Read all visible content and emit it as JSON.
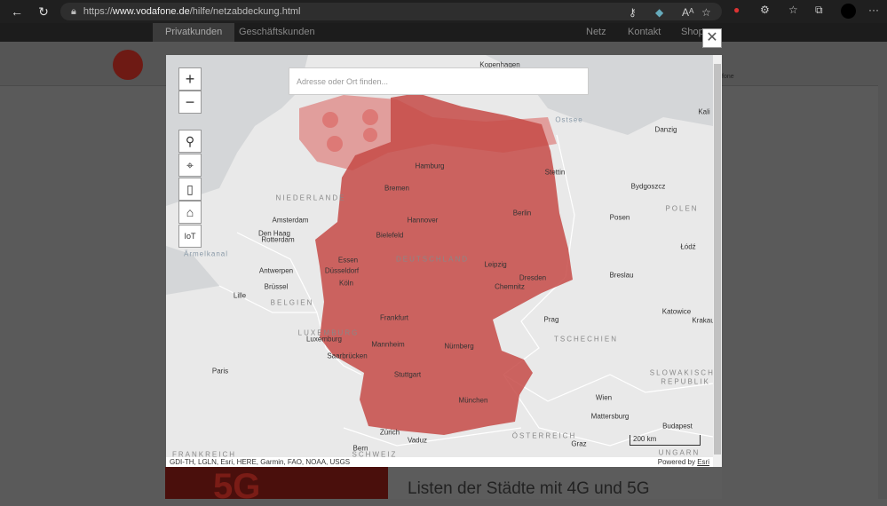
{
  "browser": {
    "url_prefix": "https://",
    "url_domain": "www.vodafone.de",
    "url_path": "/hilfe/netzabdeckung.html",
    "more": "···"
  },
  "nav": {
    "tabs": [
      "Privatkunden",
      "Geschäftskunden"
    ],
    "links": [
      "Netz",
      "Kontakt",
      "Shop"
    ]
  },
  "header": {
    "partial_text": "fone"
  },
  "map": {
    "search_placeholder": "Adresse oder Ort finden...",
    "labels": [
      "Kopenhagen",
      "Ostsee",
      "Kali",
      "Danzig",
      "Hamburg",
      "Stettin",
      "Bremen",
      "Bydgoszcz",
      "NIEDERLANDE",
      "POLEN",
      "Amsterdam",
      "Hannover",
      "Berlin",
      "Posen",
      "Den Haag",
      "Rotterdam",
      "Bielefeld",
      "Łódź",
      "Ärmelkanal",
      "DEUTSCHLAND",
      "Essen",
      "Leipzig",
      "Düsseldorf",
      "Antwerpen",
      "Breslau",
      "Dresden",
      "Köln",
      "Chemnitz",
      "Brüssel",
      "Lille",
      "BELGIEN",
      "Katowice",
      "Krakau",
      "Frankfurt",
      "Prag",
      "LUXEMBURG",
      "Luxemburg",
      "TSCHECHIEN",
      "Mannheim",
      "Nürnberg",
      "Saarbrücken",
      "Paris",
      "SLOWAKISCHE",
      "REPUBLIK",
      "Stuttgart",
      "Wien",
      "München",
      "Mattersburg",
      "Budapest",
      "Zürich",
      "ÖSTERREICH",
      "Vaduz",
      "Graz",
      "Bern",
      "FRANKREICH",
      "SCHWEIZ",
      "UNGARN"
    ],
    "scale": "200 km",
    "attribution": "GDI-TH, LGLN, Esri, HERE, Garmin, FAO, NOAA, USGS",
    "powered_by": "Powered by",
    "esri": "Esri",
    "coverage_color": "#d9534f"
  },
  "page": {
    "five_g": "5G",
    "heading": "Listen der Städte mit 4G und 5G"
  }
}
